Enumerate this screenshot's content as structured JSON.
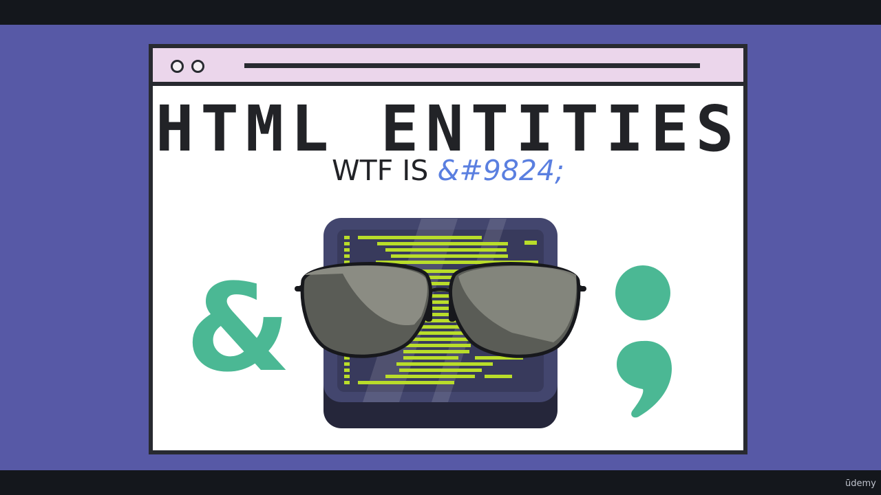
{
  "slide": {
    "title": "HTML ENTITIES",
    "subtitle_prefix": "WTF IS",
    "subtitle_code": "&#9824;",
    "ampersand_glyph": "&",
    "semicolon_glyph": ";"
  },
  "watermark": "ūdemy",
  "colors": {
    "background": "#5759a6",
    "letterbox": "#14171c",
    "titlebar": "#ebd6eb",
    "outline": "#282a30",
    "accent_green": "#4bb894",
    "code_blue": "#5a7fe0",
    "terminal_green": "#b9dd2a"
  },
  "icons": {
    "mascot": "terminal-with-aviator-sunglasses-icon"
  }
}
